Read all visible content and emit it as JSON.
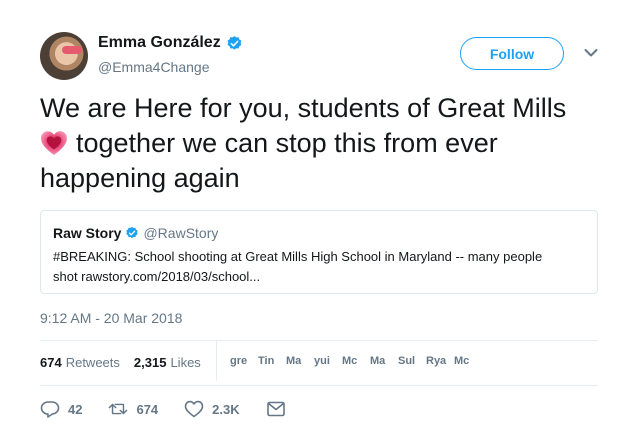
{
  "author": {
    "display_name": "Emma González",
    "handle": "@Emma4Change"
  },
  "follow_button": {
    "label": "Follow"
  },
  "tweet": {
    "line1": "We are Here for you, students of Great Mills",
    "line2": "together we can stop this from ever",
    "line3": "happening again"
  },
  "quoted_tweet": {
    "name": "Raw Story",
    "handle": "@RawStory",
    "line1": "#BREAKING: School shooting at Great Mills High School in Maryland -- many people",
    "line2": "shot rawstory.com/2018/03/school..."
  },
  "timestamp": "9:12 AM - 20 Mar 2018",
  "stats": {
    "retweets_count": "674",
    "retweets_label": "Retweets",
    "likes_count": "2,315",
    "likes_label": "Likes"
  },
  "likers": [
    "gre",
    "Tin",
    "Ma",
    "yui",
    "Mc",
    "Ma",
    "Sul",
    "Rya",
    "Mc"
  ],
  "actions": {
    "reply_count": "42",
    "retweet_count": "674",
    "like_count": "2.3K"
  },
  "colors": {
    "accent": "#1da1f2",
    "secondary_text": "#657786",
    "heart": "#e0245e"
  },
  "icons": [
    "verified-badge-icon",
    "chevron-down-icon",
    "heart-emoji-icon",
    "reply-icon",
    "retweet-icon",
    "like-icon",
    "direct-message-icon"
  ]
}
